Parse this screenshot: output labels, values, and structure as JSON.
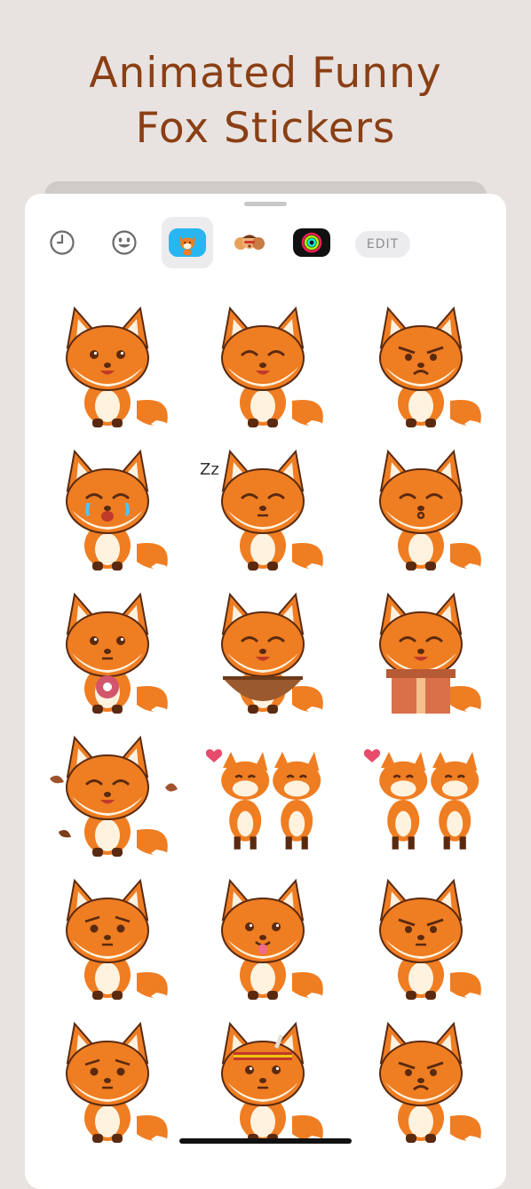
{
  "headline": {
    "line1": "Animated Funny",
    "line2": "Fox Stickers"
  },
  "toolbar": {
    "tabs": [
      {
        "icon": "clock-icon",
        "active": false
      },
      {
        "icon": "smiley-icon",
        "active": false
      },
      {
        "icon": "fox-sticker-pack-icon",
        "active": true
      },
      {
        "icon": "memoji-pack-icon",
        "active": false
      },
      {
        "icon": "activity-rings-icon",
        "active": false
      }
    ],
    "edit_label": "EDIT"
  },
  "stickers": [
    {
      "name": "fox-happy-sticker",
      "mood": "happy"
    },
    {
      "name": "fox-squint-smile-sticker",
      "mood": "squint"
    },
    {
      "name": "fox-angry-sticker",
      "mood": "angry"
    },
    {
      "name": "fox-crying-sticker",
      "mood": "crying"
    },
    {
      "name": "fox-sleeping-sticker",
      "mood": "sleeping",
      "caption": "Zz"
    },
    {
      "name": "fox-kiss-sticker",
      "mood": "kiss"
    },
    {
      "name": "fox-donut-sticker",
      "mood": "donut"
    },
    {
      "name": "fox-basket-sticker",
      "mood": "basket"
    },
    {
      "name": "fox-gift-box-sticker",
      "mood": "gift"
    },
    {
      "name": "fox-leaves-sticker",
      "mood": "leaves"
    },
    {
      "name": "fox-couple-sticker",
      "mood": "couple"
    },
    {
      "name": "fox-couple-gift-sticker",
      "mood": "couple2"
    },
    {
      "name": "fox-sad-sticker",
      "mood": "sad"
    },
    {
      "name": "fox-tongue-sticker",
      "mood": "tongue"
    },
    {
      "name": "fox-grumpy-sticker",
      "mood": "grumpy"
    },
    {
      "name": "fox-worried-sticker",
      "mood": "worried"
    },
    {
      "name": "fox-headband-sticker",
      "mood": "headband"
    },
    {
      "name": "fox-mad-sticker",
      "mood": "mad"
    }
  ],
  "colors": {
    "headline": "#8a3f14",
    "fox_orange": "#ef7d22",
    "fox_dark": "#5a2a10",
    "fox_cream": "#fff3df",
    "background": "#e8e3e1"
  }
}
